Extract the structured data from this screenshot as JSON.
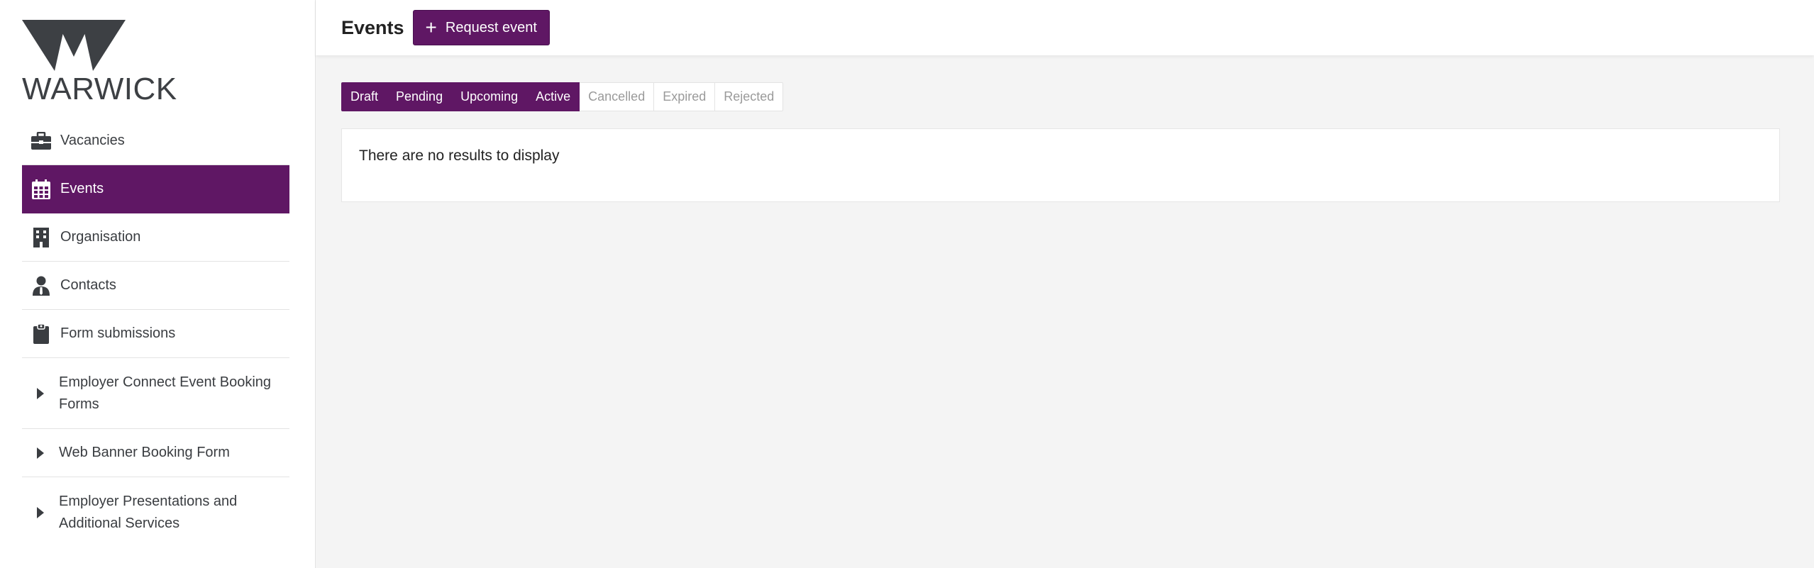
{
  "logo": {
    "text": "WARWICK"
  },
  "sidebar": {
    "items": [
      {
        "label": "Vacancies",
        "icon": "briefcase-icon",
        "active": false
      },
      {
        "label": "Events",
        "icon": "calendar-icon",
        "active": true
      },
      {
        "label": "Organisation",
        "icon": "building-icon",
        "active": false
      },
      {
        "label": "Contacts",
        "icon": "person-icon",
        "active": false
      },
      {
        "label": "Form submissions",
        "icon": "clipboard-icon",
        "active": false
      },
      {
        "label": "Employer Connect Event Booking Forms",
        "icon": "caret-right-icon",
        "active": false
      },
      {
        "label": "Web Banner Booking Form",
        "icon": "caret-right-icon",
        "active": false
      },
      {
        "label": "Employer Presentations and Additional Services",
        "icon": "caret-right-icon",
        "active": false
      }
    ]
  },
  "header": {
    "title": "Events",
    "request_button": "Request event"
  },
  "tabs": [
    {
      "label": "Draft",
      "selected": true
    },
    {
      "label": "Pending",
      "selected": true
    },
    {
      "label": "Upcoming",
      "selected": true
    },
    {
      "label": "Active",
      "selected": true
    },
    {
      "label": "Cancelled",
      "selected": false
    },
    {
      "label": "Expired",
      "selected": false
    },
    {
      "label": "Rejected",
      "selected": false
    }
  ],
  "results": {
    "empty_message": "There are no results to display"
  },
  "colors": {
    "brand": "#5f1764",
    "icon": "#3a3d41",
    "logo": "#3d4044"
  }
}
